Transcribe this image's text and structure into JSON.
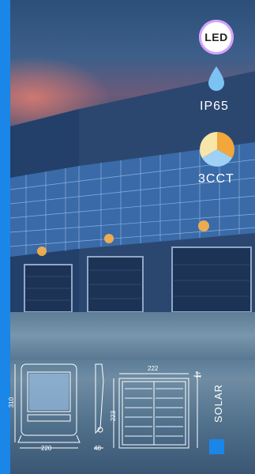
{
  "badges": {
    "led": "LED",
    "ip": "IP65",
    "cct": "3CCT"
  },
  "dimensions": {
    "front_height": "310",
    "front_width": "220",
    "side_depth": "48",
    "panel_width": "222",
    "panel_height": "223",
    "panel_thickness": "17"
  },
  "solar_label": "SOLAR",
  "colors": {
    "accent_blue": "#1a86e8",
    "cct_warm": "#f2a73b",
    "cct_neutral": "#f7e6a8",
    "cct_cool": "#9fd0f5",
    "water_drop": "#7cc3f4"
  }
}
